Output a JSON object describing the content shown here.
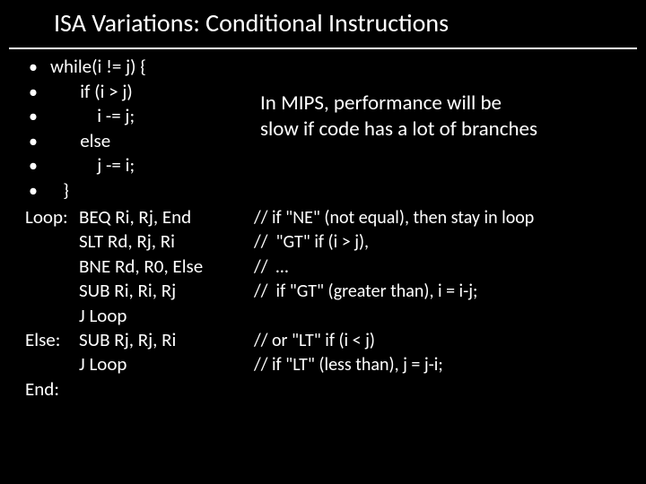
{
  "title": "ISA Variations: Conditional Instructions",
  "bullets": [
    "while(i != j) {",
    "       if (i > j)",
    "           i -= j;",
    "       else",
    "           j -= i;",
    "   }"
  ],
  "callout": {
    "line1": "In MIPS, performance will be",
    "line2": "slow if code has a lot of branches"
  },
  "asm": [
    {
      "label": "Loop:",
      "instr": "BEQ Ri, Rj, End",
      "comment": "// if \"NE\" (not equal), then stay in loop"
    },
    {
      "label": "",
      "instr": "SLT Rd, Rj, Ri",
      "comment": "//  \"GT\" if (i > j),"
    },
    {
      "label": "",
      "instr": "BNE Rd, R0, Else",
      "comment": "//  …"
    },
    {
      "label": "",
      "instr": "SUB Ri, Ri, Rj",
      "comment": "//  if \"GT\" (greater than), i = i-j;"
    },
    {
      "label": "",
      "instr": "J Loop",
      "comment": ""
    },
    {
      "label": "Else:",
      "instr": "SUB Rj, Rj, Ri",
      "comment": "// or \"LT\" if (i < j)"
    },
    {
      "label": "",
      "instr": "J Loop",
      "comment": "// if \"LT\" (less than), j = j-i;"
    },
    {
      "label": "End:",
      "instr": "",
      "comment": ""
    }
  ]
}
